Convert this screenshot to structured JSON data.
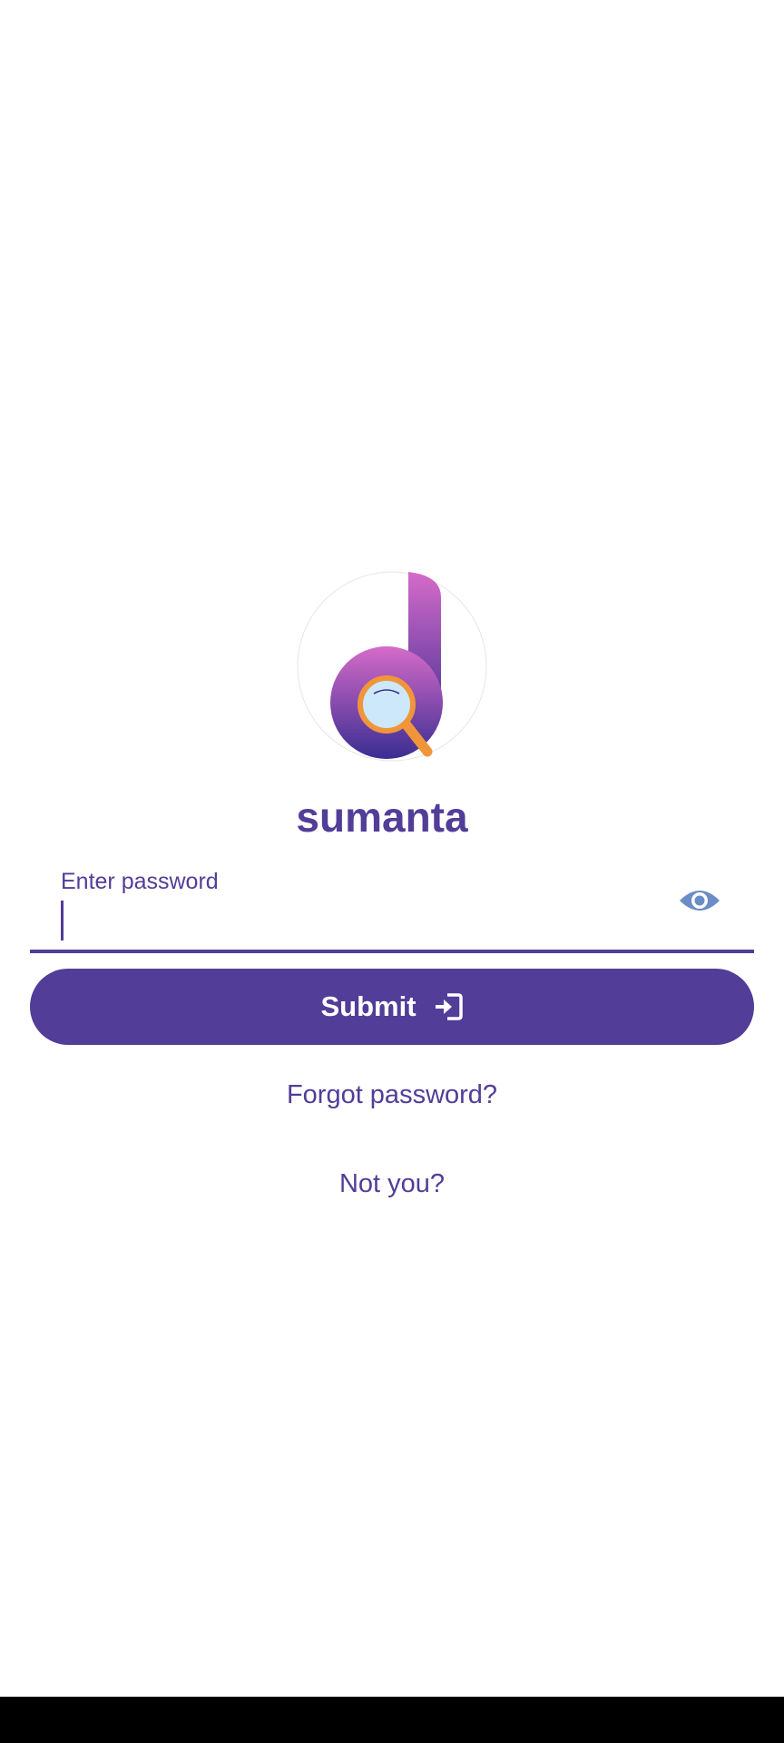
{
  "user": {
    "name": "sumanta"
  },
  "password_field": {
    "label": "Enter password",
    "value": "",
    "visibility_icon": "eye-icon"
  },
  "actions": {
    "submit_label": "Submit",
    "submit_icon": "login-icon",
    "forgot_label": "Forgot password?",
    "not_you_label": "Not you?"
  },
  "colors": {
    "primary": "#523d98",
    "eye_icon": "#6b8cc7",
    "logo_gradient_top": "#d56bc9",
    "logo_gradient_bottom": "#3a2d92",
    "magnifier_ring": "#f0953a",
    "magnifier_lens": "#cde8fb"
  }
}
